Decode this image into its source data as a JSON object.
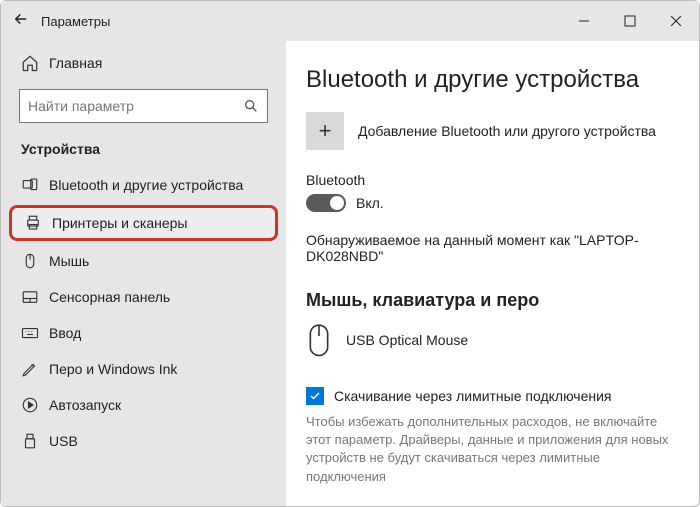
{
  "titlebar": {
    "title": "Параметры"
  },
  "sidebar": {
    "home": "Главная",
    "search_placeholder": "Найти параметр",
    "category": "Устройства",
    "items": [
      {
        "label": "Bluetooth и другие устройства"
      },
      {
        "label": "Принтеры и сканеры"
      },
      {
        "label": "Мышь"
      },
      {
        "label": "Сенсорная панель"
      },
      {
        "label": "Ввод"
      },
      {
        "label": "Перо и Windows Ink"
      },
      {
        "label": "Автозапуск"
      },
      {
        "label": "USB"
      }
    ]
  },
  "main": {
    "heading": "Bluetooth и другие устройства",
    "add_label": "Добавление Bluetooth или другого устройства",
    "bluetooth_label": "Bluetooth",
    "toggle_state": "Вкл.",
    "discoverable": "Обнаруживаемое на данный момент как \"LAPTOP-DK028NBD\"",
    "section2": "Мышь, клавиатура и перо",
    "device1": "USB Optical Mouse",
    "metered_label": "Скачивание через лимитные подключения",
    "metered_help": "Чтобы избежать дополнительных расходов, не включайте этот параметр. Драйверы, данные и приложения для новых устройств не будут скачиваться через лимитные подключения"
  }
}
